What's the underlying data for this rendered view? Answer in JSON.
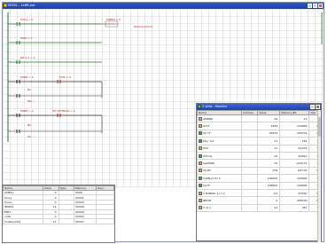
{
  "window": {
    "title": "M2M1 - 1x8R.pro"
  },
  "ladder": {
    "rungs": [
      {
        "label": "Dorig > 0",
        "coil": "M0BIN > 0",
        "coil_tag": "Dtrend Instrot"
      },
      {
        "label": "M2M > 0"
      },
      {
        "label": "Dfl 2-1 > 0"
      },
      {
        "label": "M0B0 > 0",
        "branch_label": "Pfd2 > 0"
      },
      {
        "label": "M0B2 > 0",
        "branch_label": "M2 pEHEDS1 > 0"
      }
    ],
    "small_labels": [
      "B1",
      "M0",
      "B0",
      "A0"
    ]
  },
  "tag_table": {
    "columns": [
      "Name",
      "Value",
      "Type",
      "Memory",
      "Desc"
    ],
    "rows": [
      [
        "AMBlnc",
        "0",
        "",
        "X000",
        ""
      ],
      [
        "Dorig",
        "0",
        "",
        "X0001",
        ""
      ],
      [
        "Tcnev",
        "0",
        "",
        "X0000",
        ""
      ],
      [
        "IMW02",
        "12",
        "",
        "X0009",
        ""
      ],
      [
        "EMH",
        "0",
        "",
        "X0000",
        ""
      ],
      [
        "ocatr",
        "0",
        "",
        "X0002",
        ""
      ],
      [
        "TcnPanuHist",
        "17",
        "",
        "X0007",
        ""
      ]
    ]
  },
  "watch": {
    "title": "2 view - Monitor",
    "columns": [
      "Name",
      "Address",
      "Value",
      "Memory Bit",
      "Det"
    ],
    "rows": [
      {
        "icon_color": "#d8b33a",
        "name": "AMBND",
        "addr": "",
        "value": "30",
        "mem": "13",
        "det": ""
      },
      {
        "icon_color": "#d8b33a",
        "name": "ALFT",
        "addr": "",
        "value": "2289",
        "mem": "229999",
        "det": "0"
      },
      {
        "icon_color": "#3fa13f",
        "name": "Mr 73",
        "addr": "",
        "value": "43670",
        "mem": "436734",
        "det": "0"
      },
      {
        "icon_color": "#3fa13f",
        "name": "Pby: %rt",
        "addr": "",
        "value": "31",
        "mem": "181",
        "det": "1"
      },
      {
        "icon_color": "#d8b33a",
        "name": "Mrtr",
        "addr": "",
        "value": "31",
        "mem": "4/1076",
        "det": "1"
      },
      {
        "icon_color": "#3fa13f",
        "name": "rMrcdv",
        "addr": "",
        "value": "42",
        "mem": "4/0612",
        "det": "1"
      },
      {
        "icon_color": "#d8b33a",
        "name": "hwdMRD",
        "addr": "",
        "value": "55",
        "mem": "1200:70",
        "det": "1"
      },
      {
        "icon_color": "#d8b33a",
        "name": "VbdM",
        "addr": "",
        "value": "256",
        "mem": "10H:34",
        "det": "0"
      },
      {
        "icon_color": "#3fa13f",
        "name": "CaPNud TC-S",
        "addr": "",
        "value": "226000",
        "mem": "220000",
        "det": "1"
      },
      {
        "icon_color": "#3fa13f",
        "name": "Kp7P",
        "addr": "",
        "value": "228000",
        "mem": "228000",
        "det": "1"
      },
      {
        "icon_color": "#d8b33a",
        "name": "T B3M0Rr 1+1 2",
        "addr": "",
        "value": "1/2",
        "mem": "43/M2/",
        "det": "0"
      },
      {
        "icon_color": "#d8b33a",
        "name": "NB18t",
        "addr": "",
        "value": "0",
        "mem": "458700",
        "det": "0"
      },
      {
        "icon_color": "#d8b33a",
        "name": "T-ns 1",
        "addr": "",
        "value": "91",
        "mem": "251",
        "det": "1"
      }
    ]
  }
}
